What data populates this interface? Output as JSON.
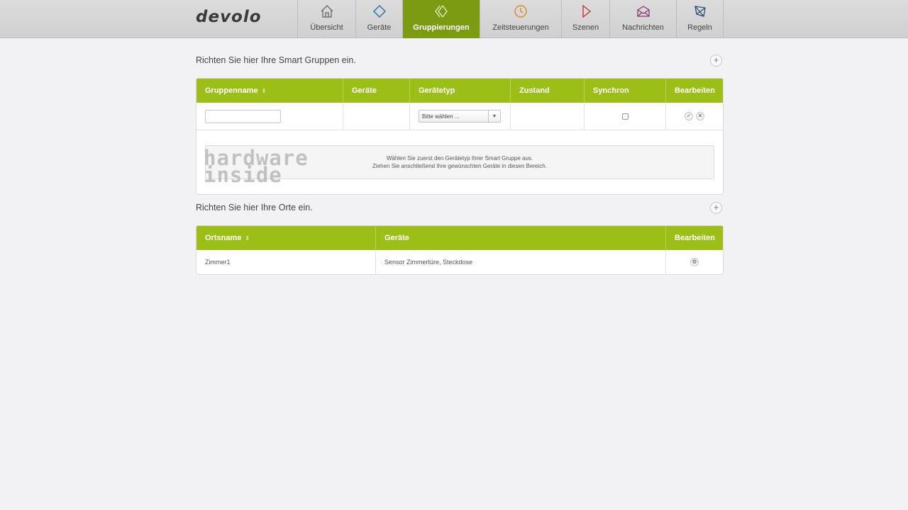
{
  "header": {
    "logo": "devolo",
    "nav": [
      {
        "label": "Übersicht",
        "icon": "home-icon",
        "color": "#555555"
      },
      {
        "label": "Geräte",
        "icon": "diamond-icon",
        "color": "#2a6f9e"
      },
      {
        "label": "Gruppierungen",
        "icon": "group-icon",
        "color": "#ffffff",
        "active": true
      },
      {
        "label": "Zeitsteuerungen",
        "icon": "clock-icon",
        "color": "#d98a24"
      },
      {
        "label": "Szenen",
        "icon": "play-icon",
        "color": "#c2363f"
      },
      {
        "label": "Nachrichten",
        "icon": "envelope-icon",
        "color": "#8a3a6d"
      },
      {
        "label": "Regeln",
        "icon": "rules-icon",
        "color": "#2c4a7a"
      }
    ]
  },
  "groups": {
    "title": "Richten Sie hier Ihre Smart Gruppen ein.",
    "add_label": "+",
    "columns": [
      "Gruppenname",
      "Geräte",
      "Gerätetyp",
      "Zustand",
      "Synchron",
      "Bearbeiten"
    ],
    "sort_icon": "⇕",
    "name_value": "",
    "select_value": "Bitte wählen ...",
    "dropzone_line1": "Wählen Sie zuerst den Gerätetyp Ihrer Smart Gruppe aus.",
    "dropzone_line2": "Ziehen Sie anschließend Ihre gewünschten Geräte in diesen Bereich.",
    "confirm_symbol": "✓",
    "cancel_symbol": "✕"
  },
  "watermark": {
    "line1": "hardware",
    "line2": "inside"
  },
  "places": {
    "title": "Richten Sie hier Ihre Orte ein.",
    "add_label": "+",
    "columns": [
      "Ortsname",
      "Geräte",
      "Bearbeiten"
    ],
    "rows": [
      {
        "name": "Zimmer1",
        "devices": "Sensor Zimmertüre, Steckdose"
      }
    ],
    "settings_symbol": "⚙"
  },
  "colors": {
    "accent": "#9bbf16",
    "nav_active": "#7b9b12"
  }
}
